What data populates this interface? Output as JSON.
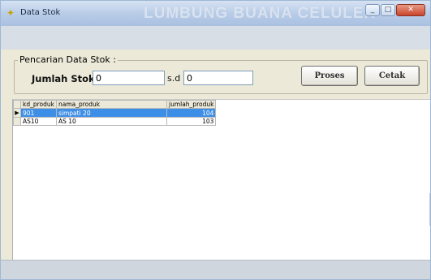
{
  "window": {
    "title": "Data Stok",
    "watermark": "LUMBUNG BUANA CELULER",
    "minimize_glyph": "_",
    "maximize_glyph": "□",
    "close_glyph": "✕"
  },
  "search": {
    "legend": "Pencarian Data Stok :",
    "jumlah_label": "Jumlah Stok :",
    "from_value": "0",
    "sd_label": "s.d",
    "to_value": "0",
    "proses_label": "Proses",
    "cetak_label": "Cetak"
  },
  "table": {
    "columns": [
      "kd_produk",
      "nama_produk",
      "jumlah_produk"
    ],
    "rows": [
      {
        "kd_produk": "901",
        "nama_produk": "simpati 20",
        "jumlah_produk": "104",
        "selected": true
      },
      {
        "kd_produk": "AS10",
        "nama_produk": "AS 10",
        "jumlah_produk": "103",
        "selected": false
      }
    ],
    "current_row_marker": "▶"
  }
}
